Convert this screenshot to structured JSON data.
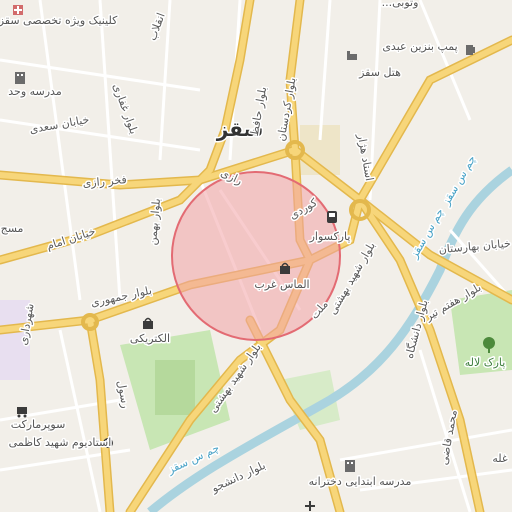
{
  "map": {
    "city_label": "سقز",
    "labels": {
      "clinic": "کلینیک ویژه تخصصی سقز",
      "school_vahdat": "مدرسه وحد",
      "gas_station": "پمپ بنزین عبدی",
      "hotel": "هتل سقز",
      "top_right_cut": "...وتوبی",
      "parksuar": "پارکسوار",
      "almas_gharb": "الماس غرب",
      "electricity": "الکتریکی",
      "supermarket": "سوپرمارکت",
      "stadium": "استادیوم شهید کاظمی",
      "school_dokhtaraneh": "مدرسه ابتدایی دخترانه",
      "park_laleh": "پارک لاله",
      "masjed": "مسج",
      "ghaleh": "غله"
    },
    "roads": {
      "saadi": "خیابان سعدی",
      "imam": "خیابان امام",
      "farhad_razi": "فخر رازی",
      "jomhouri": "بلوار جمهوری",
      "shahrdari": "شهرداری",
      "kurdistan": "بلوار کردستان",
      "hafez": "بلوار حافظ",
      "ostad_hejar": "استاد هژار",
      "shahid_beheshti": "بلوار شهید بهشتی",
      "shahid_beheshti_2": "بلوار شهید بهشتی",
      "daneshgah": "بلوار دانشگاه",
      "daneshjoo": "بلوار دانشجو",
      "haft_tir": "بلوار هفتم تیر",
      "bahrestan": "خیابان بهارستان",
      "razi": "رازی",
      "kurdi": "کوردی",
      "mellat": "ملت",
      "bahman": "بلوار بهمن",
      "enghelab": "انقلاب",
      "mohammad_ghazi": "محمد قاضی",
      "rasool": "رسول",
      "ghafari": "بلوار غفاری",
      "river": "چم س سقز",
      "river_2": "چم س سقز",
      "river_3": "چم س سقز"
    }
  },
  "colors": {
    "background": "#f2efe9",
    "road_major": "#f7d67a",
    "road_major_edge": "#e3b84d",
    "road_minor": "#ffffff",
    "river": "#aad3df",
    "park": "#c8e6b4",
    "stadium": "#b5d99c",
    "highlight_fill": "#f2a3a6",
    "highlight_edge": "#e36b73"
  },
  "highlight": {
    "shape": "circle"
  },
  "icons": [
    "school-icon",
    "gas-pump-icon",
    "hotel-icon",
    "bus-stop-icon",
    "shopping-bag-icon",
    "stadium-icon",
    "park-tree-icon",
    "hospital-icon"
  ]
}
